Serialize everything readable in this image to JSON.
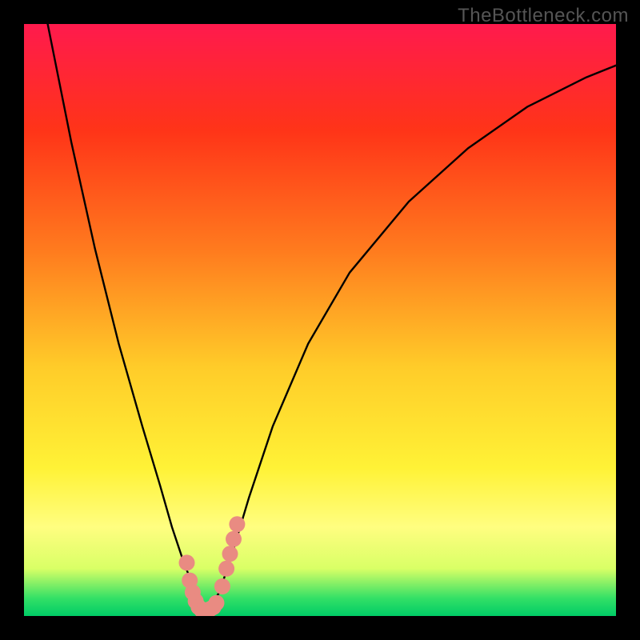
{
  "watermark": "TheBottleneck.com",
  "chart_data": {
    "type": "line",
    "title": "",
    "xlabel": "",
    "ylabel": "",
    "xlim": [
      0,
      100
    ],
    "ylim": [
      0,
      100
    ],
    "series": [
      {
        "name": "curve",
        "x": [
          4,
          8,
          12,
          16,
          20,
          23,
          25,
          27,
          29,
          30,
          31,
          33,
          35,
          38,
          42,
          48,
          55,
          65,
          75,
          85,
          95,
          100
        ],
        "y": [
          100,
          80,
          62,
          46,
          32,
          22,
          15,
          9,
          4,
          1,
          1,
          4,
          10,
          20,
          32,
          46,
          58,
          70,
          79,
          86,
          91,
          93
        ]
      },
      {
        "name": "highlight-dots",
        "x": [
          27.5,
          28.0,
          28.5,
          29.0,
          29.5,
          30.0,
          30.5,
          31.0,
          31.5,
          32.0,
          32.5,
          33.5,
          34.2,
          34.8,
          35.4,
          36.0
        ],
        "y": [
          9,
          6,
          4,
          2.5,
          1.5,
          1,
          1,
          1,
          1.2,
          1.5,
          2.2,
          5,
          8,
          10.5,
          13,
          15.5
        ]
      }
    ],
    "colors": {
      "curve": "#000000",
      "dots": "#e98b82",
      "gradient_top": "#ff1a4d",
      "gradient_bottom": "#00cc66"
    }
  }
}
